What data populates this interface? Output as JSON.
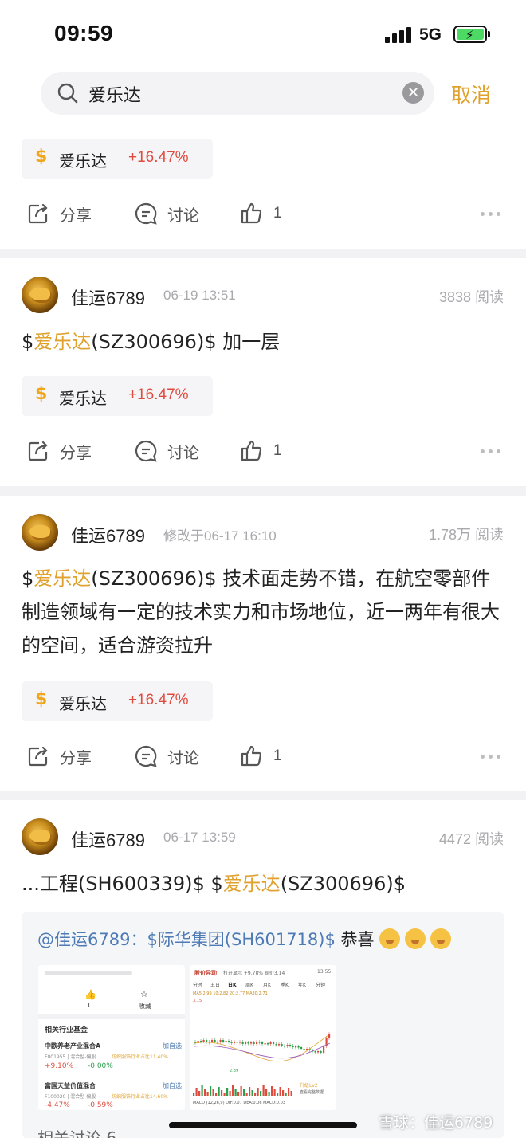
{
  "status_bar": {
    "time": "09:59",
    "network": "5G"
  },
  "search": {
    "query": "爱乐达",
    "cancel_label": "取消"
  },
  "actions_labels": {
    "share": "分享",
    "discuss": "讨论"
  },
  "stock_chip": {
    "name": "爱乐达",
    "change": "+16.47%",
    "currency_symbol": "$"
  },
  "colors": {
    "accent": "#e0a12d",
    "up": "#e04b3f",
    "link_blue": "#4e7bb5"
  },
  "post0": {
    "likes": "1"
  },
  "post1": {
    "author": "佳运6789",
    "time": "06-19 13:51",
    "reads": "3838 阅读",
    "text_pre": "$",
    "text_link": "爱乐达",
    "text_post": "(SZ300696)$ 加一层",
    "likes": "1"
  },
  "post2": {
    "author": "佳运6789",
    "time": "修改于06-17 16:10",
    "reads": "1.78万 阅读",
    "text_pre": "$",
    "text_link": "爱乐达",
    "text_post": "(SZ300696)$ 技术面走势不错，在航空零部件制造领域有一定的技术实力和市场地位，近一两年有很大的空间，适合游资拉升",
    "likes": "1"
  },
  "post3": {
    "author": "佳运6789",
    "time": "06-17 13:59",
    "reads": "4472 阅读",
    "text_pre": "...工程(SH600339)$ $",
    "text_link": "爱乐达",
    "text_post": "(SZ300696)$",
    "repost_text_link": "@佳运6789：$际华集团(SH601718)$",
    "repost_text_post": " 恭喜",
    "thumb1": {
      "tab_like_count": "1",
      "tab_fav": "收藏",
      "section_title": "相关行业基金",
      "fund1_name": "中欧养老产业混合A",
      "fund1_code": "F001955 | 混合型-偏股",
      "fund1_tag": "纺织服饰行业占比11.40%",
      "fund1_pct1": "+9.10%",
      "fund1_pct2": "-0.00%",
      "fund1_btn": "加自选",
      "fund2_name": "富国天益价值混合",
      "fund2_code": "F100020 | 混合型-偏股",
      "fund2_tag": "纺织服饰行业占比14.60%",
      "fund2_pct1": "-4.47%",
      "fund2_pct2": "-0.59%",
      "fund2_btn": "加自选"
    },
    "thumb2": {
      "title": "股价异动",
      "sub": "打开显示 +9.78% 现价3.14",
      "time": "13:55",
      "tabs": [
        "分时",
        "五日",
        "日K",
        "周K",
        "月K",
        "季K",
        "年K",
        "分钟"
      ],
      "ma_text": "MA5 2.99  10:2.82  20:2.77  MA30:2.71",
      "price_top": "3.15",
      "price_low": "2.39",
      "macd_text": "MACD (12,26,9)  DIF:0.07  DEA:0.06  MACD:0.03",
      "upgrade": "升级Lv2",
      "upgrade_sub": "查看完整数据"
    }
  },
  "watermark": "雪球：佳运6789",
  "related": "相关讨论 6"
}
